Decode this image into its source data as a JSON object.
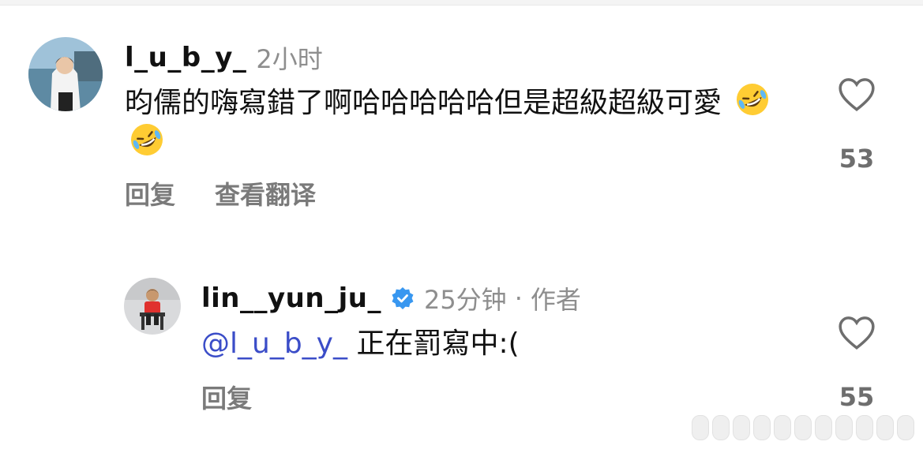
{
  "comments": [
    {
      "username": "l_u_b_y_",
      "time": "2小时",
      "text": "昀儒的嗨寫錯了啊哈哈哈哈哈但是超級超級可愛",
      "emoji": "rolling-on-floor-laughing",
      "actions": {
        "reply": "回复",
        "translate": "查看翻译"
      },
      "likes": "53"
    },
    {
      "username": "lin__yun_ju_",
      "verified": true,
      "time": "25分钟",
      "separator": "·",
      "author_label": "作者",
      "mention": "@l_u_b_y_",
      "text": "正在罰寫中:(",
      "actions": {
        "reply": "回复"
      },
      "likes": "55"
    }
  ],
  "colors": {
    "mention": "#3b4dc8",
    "verified": "#3897f0",
    "muted": "#8e8e8e"
  }
}
